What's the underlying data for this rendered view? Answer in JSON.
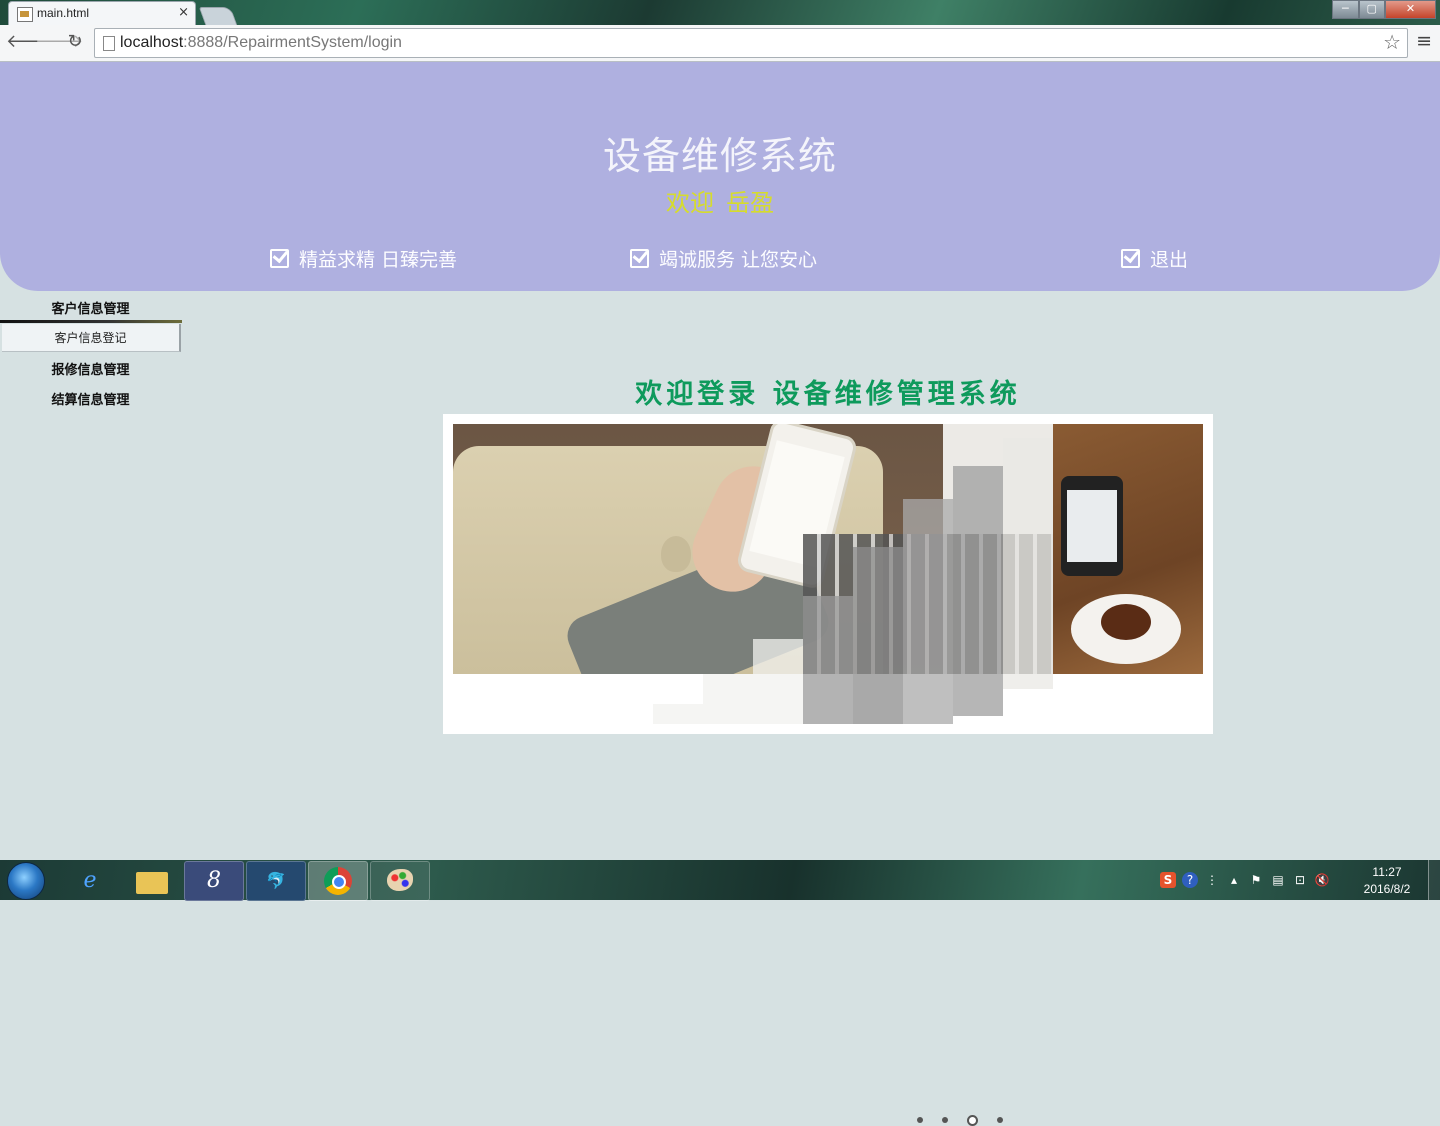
{
  "browser": {
    "tab_title": "main.html",
    "tab_close": "×",
    "url_host": "localhost",
    "url_rest": ":8888/RepairmentSystem/login",
    "window_controls": {
      "minimize": "─",
      "maximize": "▢",
      "close": "✕"
    }
  },
  "header": {
    "title": "设备维修系统",
    "welcome_label": "欢迎",
    "user_name": "岳盈",
    "nav": [
      {
        "label": "精益求精  日臻完善"
      },
      {
        "label": "竭诚服务  让您安心"
      },
      {
        "label": "退出"
      }
    ]
  },
  "sidebar": {
    "groups": [
      {
        "title": "客户信息管理",
        "items": [
          {
            "label": "客户信息登记"
          }
        ]
      },
      {
        "title": "报修信息管理"
      },
      {
        "title": "结算信息管理"
      }
    ]
  },
  "main": {
    "title": "欢迎登录 设备维修管理系统",
    "slider": {
      "dot_count": 4,
      "active_dot": 2
    }
  },
  "taskbar": {
    "apps": [
      "start-orb",
      "ie-icon",
      "folder-icon",
      "app-8-icon",
      "mysql-icon",
      "chrome-icon",
      "paint-icon"
    ],
    "clock_time": "11:27",
    "clock_date": "2016/8/2"
  }
}
